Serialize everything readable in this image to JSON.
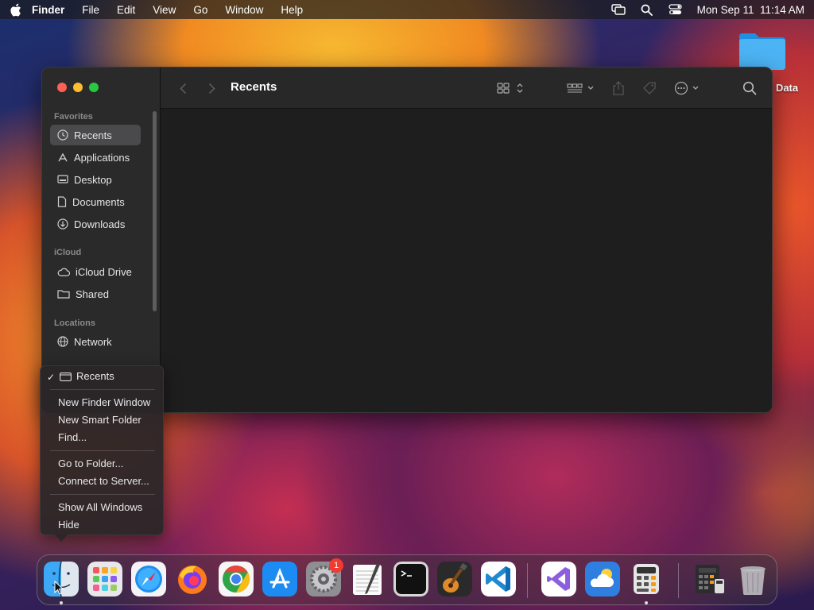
{
  "menubar": {
    "app_name": "Finder",
    "menus": [
      "File",
      "Edit",
      "View",
      "Go",
      "Window",
      "Help"
    ],
    "clock": "Mon Sep 11  11:14 AM",
    "icons": [
      "apple-icon",
      "screen-mirroring-icon",
      "spotlight-search-icon",
      "control-center-icon"
    ]
  },
  "desktop": {
    "folder_label": "t Data"
  },
  "finder": {
    "title": "Recents",
    "sidebar": {
      "favorites_header": "Favorites",
      "icloud_header": "iCloud",
      "locations_header": "Locations",
      "items": [
        {
          "label": "Recents",
          "icon": "clock-icon",
          "selected": true
        },
        {
          "label": "Applications",
          "icon": "applications-icon"
        },
        {
          "label": "Desktop",
          "icon": "desktop-icon"
        },
        {
          "label": "Documents",
          "icon": "document-icon"
        },
        {
          "label": "Downloads",
          "icon": "download-icon"
        },
        {
          "label": "iCloud Drive",
          "icon": "cloud-icon"
        },
        {
          "label": "Shared",
          "icon": "shared-folder-icon"
        },
        {
          "label": "Network",
          "icon": "globe-icon"
        }
      ]
    }
  },
  "context_menu": {
    "items": [
      {
        "label": "Recents",
        "checked": true
      },
      {
        "label": "New Finder Window"
      },
      {
        "label": "New Smart Folder"
      },
      {
        "label": "Find..."
      },
      {
        "label": "Go to Folder..."
      },
      {
        "label": "Connect to Server..."
      },
      {
        "label": "Show All Windows"
      },
      {
        "label": "Hide"
      }
    ]
  },
  "dock": {
    "apps": [
      "Finder",
      "Launchpad",
      "Safari",
      "Firefox",
      "Chrome",
      "App Store",
      "System Settings",
      "TextEdit",
      "Terminal",
      "GarageBand",
      "Visual Studio Code",
      "Visual Studio",
      "Weather",
      "Calculator",
      "Calculator Folder",
      "Trash"
    ],
    "settings_badge": "1"
  },
  "colors": {
    "accent_close": "#fe5f57",
    "accent_min": "#febc2e",
    "accent_zoom": "#28c840",
    "badge": "#f03b30"
  }
}
